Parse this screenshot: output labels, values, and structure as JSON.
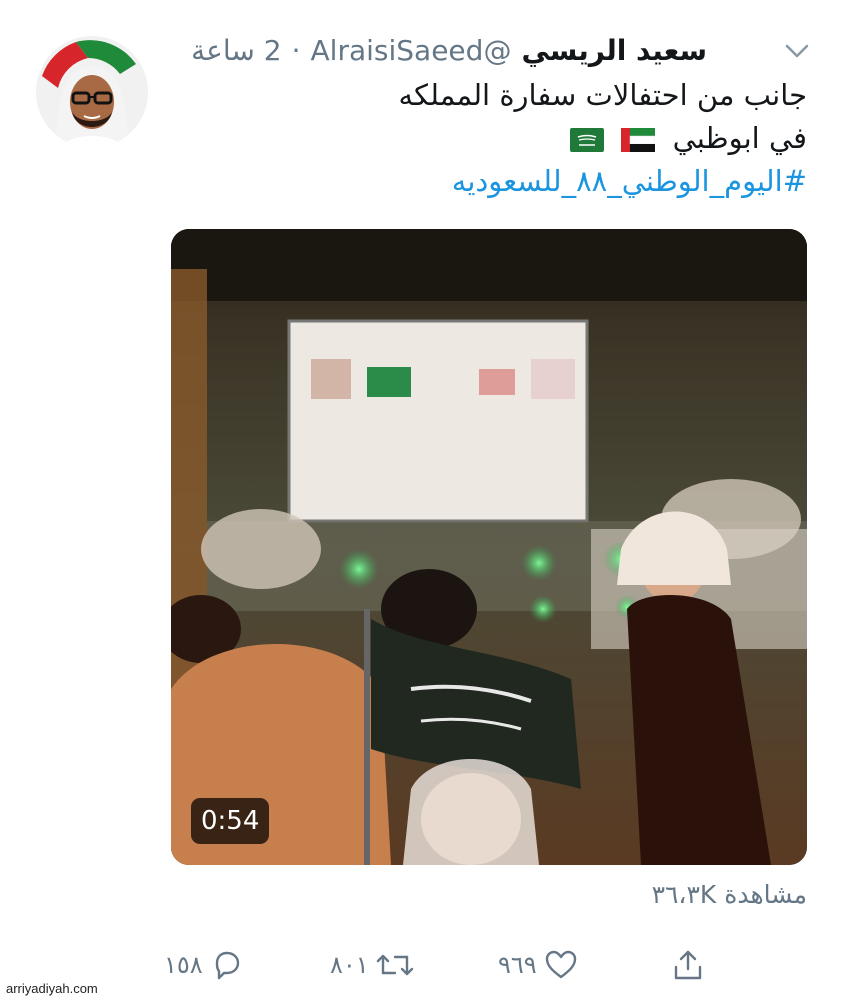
{
  "tweet": {
    "author_name": "سعيد الريسي",
    "handle": "@AlraisiSaeed",
    "separator": "·",
    "time": "2 ساعة",
    "text_line1": "جانب من احتفالات سفارة المملكه",
    "text_line2": "في ابوظبي",
    "hashtag": "#اليوم_الوطني_٨٨_للسعوديه",
    "flags": [
      "uae-flag-icon",
      "saudi-flag-icon"
    ]
  },
  "video": {
    "duration": "0:54",
    "views": "مشاهدة ٣٦،٣K"
  },
  "actions": {
    "reply_count": "١٥٨",
    "retweet_count": "٨٠١",
    "like_count": "٩٦٩"
  },
  "watermark": "arriyadiyah.com",
  "colors": {
    "link": "#1b95e0",
    "secondary_text": "#657786",
    "primary_text": "#14171a"
  }
}
